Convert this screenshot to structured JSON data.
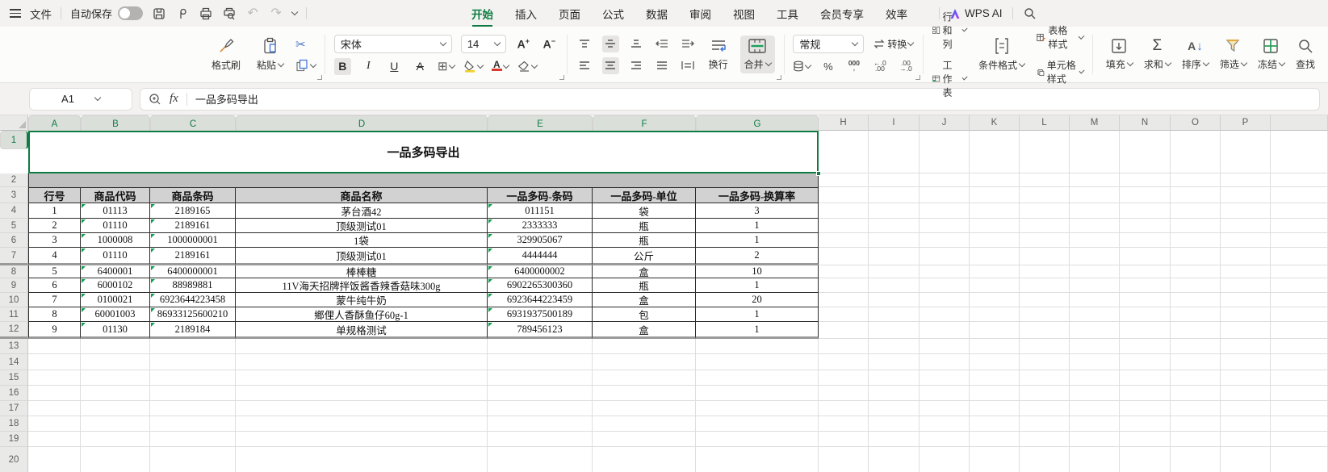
{
  "colors": {
    "accent_green": "#0e7c42",
    "selection_border": "#0e7c42",
    "gray_band": "#bfbfbf",
    "table_header_fill": "#d2d2d2",
    "marker_green": "#0d9e4f",
    "cut_blue": "#4a77c6",
    "font_color_red": "#d83b2d",
    "fill_yellow": "#f2d024"
  },
  "titlebar": {
    "menu_label": "文件",
    "autosave_label": "自动保存",
    "autosave_on": false,
    "quick_access_icons": [
      "save",
      "output-as-pdf",
      "print",
      "print-preview",
      "undo",
      "redo",
      "more"
    ],
    "tabs": [
      {
        "label": "开始",
        "active": true
      },
      {
        "label": "插入",
        "active": false
      },
      {
        "label": "页面",
        "active": false
      },
      {
        "label": "公式",
        "active": false
      },
      {
        "label": "数据",
        "active": false
      },
      {
        "label": "审阅",
        "active": false
      },
      {
        "label": "视图",
        "active": false
      },
      {
        "label": "工具",
        "active": false
      },
      {
        "label": "会员专享",
        "active": false
      },
      {
        "label": "效率",
        "active": false
      }
    ],
    "ai_label": "WPS AI"
  },
  "ribbon": {
    "format_painter": "格式刷",
    "paste": "粘贴",
    "font_name": "宋体",
    "font_size": "14",
    "bold": "B",
    "italic": "I",
    "underline": "U",
    "strike": "A",
    "wrap": "换行",
    "merge": "合并",
    "number_format": "常规",
    "convert": "转换",
    "comma_style": "000",
    "rows_cols": "行和列",
    "worksheet": "工作表",
    "cond_format": "条件格式",
    "table_style": "表格样式",
    "cell_style": "单元格样式",
    "fill": "填充",
    "sum": "求和",
    "sort": "排序",
    "filter": "筛选",
    "freeze": "冻结",
    "find": "查找"
  },
  "formula_bar": {
    "name_box": "A1",
    "fx": "fx",
    "content": "一品多码导出"
  },
  "sheet": {
    "title_cell": "一品多码导出",
    "columns": [
      {
        "letter": "A",
        "selected": true
      },
      {
        "letter": "B",
        "selected": true
      },
      {
        "letter": "C",
        "selected": true
      },
      {
        "letter": "D",
        "selected": true
      },
      {
        "letter": "E",
        "selected": true
      },
      {
        "letter": "F",
        "selected": true
      },
      {
        "letter": "G",
        "selected": true
      },
      {
        "letter": "H",
        "selected": false
      },
      {
        "letter": "I",
        "selected": false
      },
      {
        "letter": "J",
        "selected": false
      },
      {
        "letter": "K",
        "selected": false
      },
      {
        "letter": "L",
        "selected": false
      },
      {
        "letter": "M",
        "selected": false
      },
      {
        "letter": "N",
        "selected": false
      },
      {
        "letter": "O",
        "selected": false
      },
      {
        "letter": "P",
        "selected": false
      },
      {
        "letter": "",
        "selected": false
      }
    ],
    "row_count": 20,
    "table": {
      "headers": [
        "行号",
        "商品代码",
        "商品条码",
        "商品名称",
        "一品多码-条码",
        "一品多码-单位",
        "一品多码-换算率"
      ],
      "text_marker_columns": [
        1,
        2,
        4
      ],
      "rows": [
        [
          "1",
          "01113",
          "2189165",
          "茅台酒42",
          "011151",
          "袋",
          "3"
        ],
        [
          "2",
          "01110",
          "2189161",
          "顶级测试01",
          "2333333",
          "瓶",
          "1"
        ],
        [
          "3",
          "1000008",
          "1000000001",
          "1袋",
          "329905067",
          "瓶",
          "1"
        ],
        [
          "4",
          "01110",
          "2189161",
          "顶级测试01",
          "4444444",
          "公斤",
          "2"
        ],
        [
          "5",
          "6400001",
          "6400000001",
          "棒棒糖",
          "6400000002",
          "盒",
          "10"
        ],
        [
          "6",
          "6000102",
          "88989881",
          "11V海天招牌拌饭酱香辣香菇味300g",
          "6902265300360",
          "瓶",
          "1"
        ],
        [
          "7",
          "0100021",
          "6923644223458",
          "蒙牛纯牛奶",
          "6923644223459",
          "盒",
          "20"
        ],
        [
          "8",
          "60001003",
          "86933125600210",
          "鄉俚人香酥鱼仔60g-1",
          "6931937500189",
          "包",
          "1"
        ],
        [
          "9",
          "01130",
          "2189184",
          "单规格测试",
          "789456123",
          "盒",
          "1"
        ]
      ]
    }
  }
}
